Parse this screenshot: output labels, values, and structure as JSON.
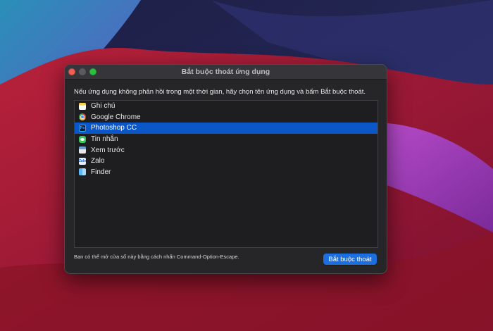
{
  "window": {
    "title": "Bắt buộc thoát ứng dụng",
    "instructions": "Nếu ứng dụng không phản hồi trong một thời gian, hãy chọn tên ứng dụng và bấm Bắt buộc thoát.",
    "footer_note": "Bạn có thể mở cửa sổ này bằng cách nhấn Command-Option-Escape.",
    "force_quit_label": "Bắt buộc thoát"
  },
  "apps": [
    {
      "name": "Ghi chú",
      "icon": "notes-icon",
      "selected": false
    },
    {
      "name": "Google Chrome",
      "icon": "chrome-icon",
      "selected": false
    },
    {
      "name": "Photoshop CC",
      "icon": "photoshop-icon",
      "icon_text": "Ps",
      "selected": true
    },
    {
      "name": "Tin nhắn",
      "icon": "messages-icon",
      "selected": false
    },
    {
      "name": "Xem trước",
      "icon": "preview-icon",
      "selected": false
    },
    {
      "name": "Zalo",
      "icon": "zalo-icon",
      "icon_text": "Zalo",
      "selected": false
    },
    {
      "name": "Finder",
      "icon": "finder-icon",
      "selected": false
    }
  ],
  "colors": {
    "selection": "#0b57c7",
    "button": "#1c6fe0",
    "window_bg": "#262528"
  }
}
